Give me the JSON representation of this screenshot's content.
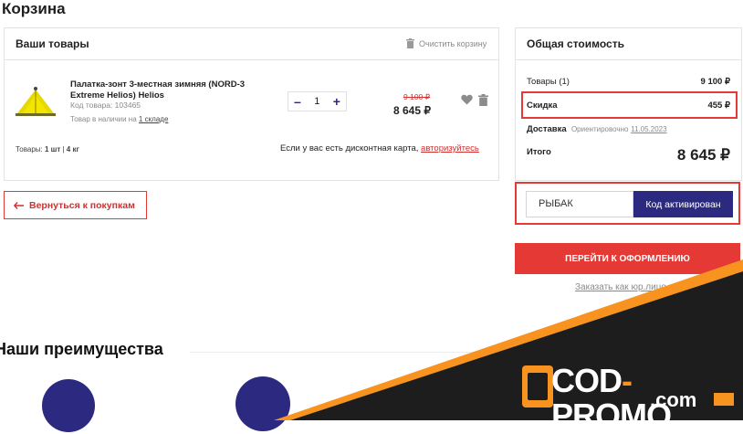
{
  "page_title": "Корзина",
  "cart": {
    "title": "Ваши товары",
    "clear_label": "Очистить корзину",
    "item": {
      "name": "Палатка-зонт 3-местная зимняя (NORD-3 Extreme Helios) Helios",
      "code": "Код товара: 103465",
      "stock_prefix": "Товар в наличии на",
      "stock_link": "1 складе",
      "qty": "1",
      "qty_minus": "–",
      "qty_plus": "+",
      "old_price": "9 100 ₽",
      "price": "8 645 ₽"
    },
    "totals_prefix": "Товары:",
    "totals_count": "1 шт",
    "totals_weight": "4 кг",
    "discount_card_text": "Если у вас есть дисконтная карта,",
    "discount_card_link": "авторизуйтесь"
  },
  "back_button": "Вернуться к покупкам",
  "summary": {
    "title": "Общая стоимость",
    "goods_label": "Товары (1)",
    "goods_value": "9 100 ₽",
    "discount_label": "Скидка",
    "discount_value": "455 ₽",
    "delivery_label": "Доставка",
    "delivery_note": "Ориентировочно",
    "delivery_date": "11.05.2023",
    "total_label": "Итого",
    "total_value": "8 645 ₽"
  },
  "promo": {
    "code": "РЫБАК",
    "button": "Код активирован"
  },
  "checkout_button": "ПЕРЕЙТИ К ОФОРМЛЕНИЮ",
  "legal_link": "Заказать как юр.лицо",
  "advantages_title": "Наши преимущества",
  "watermark": {
    "brand": "COD",
    "dash": "-",
    "brand2": "PROMO",
    "dot_com": ".com"
  },
  "colors": {
    "accent_red": "#e53935",
    "brand_navy": "#2b2a80",
    "banner_orange": "#f7931e",
    "banner_dark": "#1d1d1d"
  }
}
